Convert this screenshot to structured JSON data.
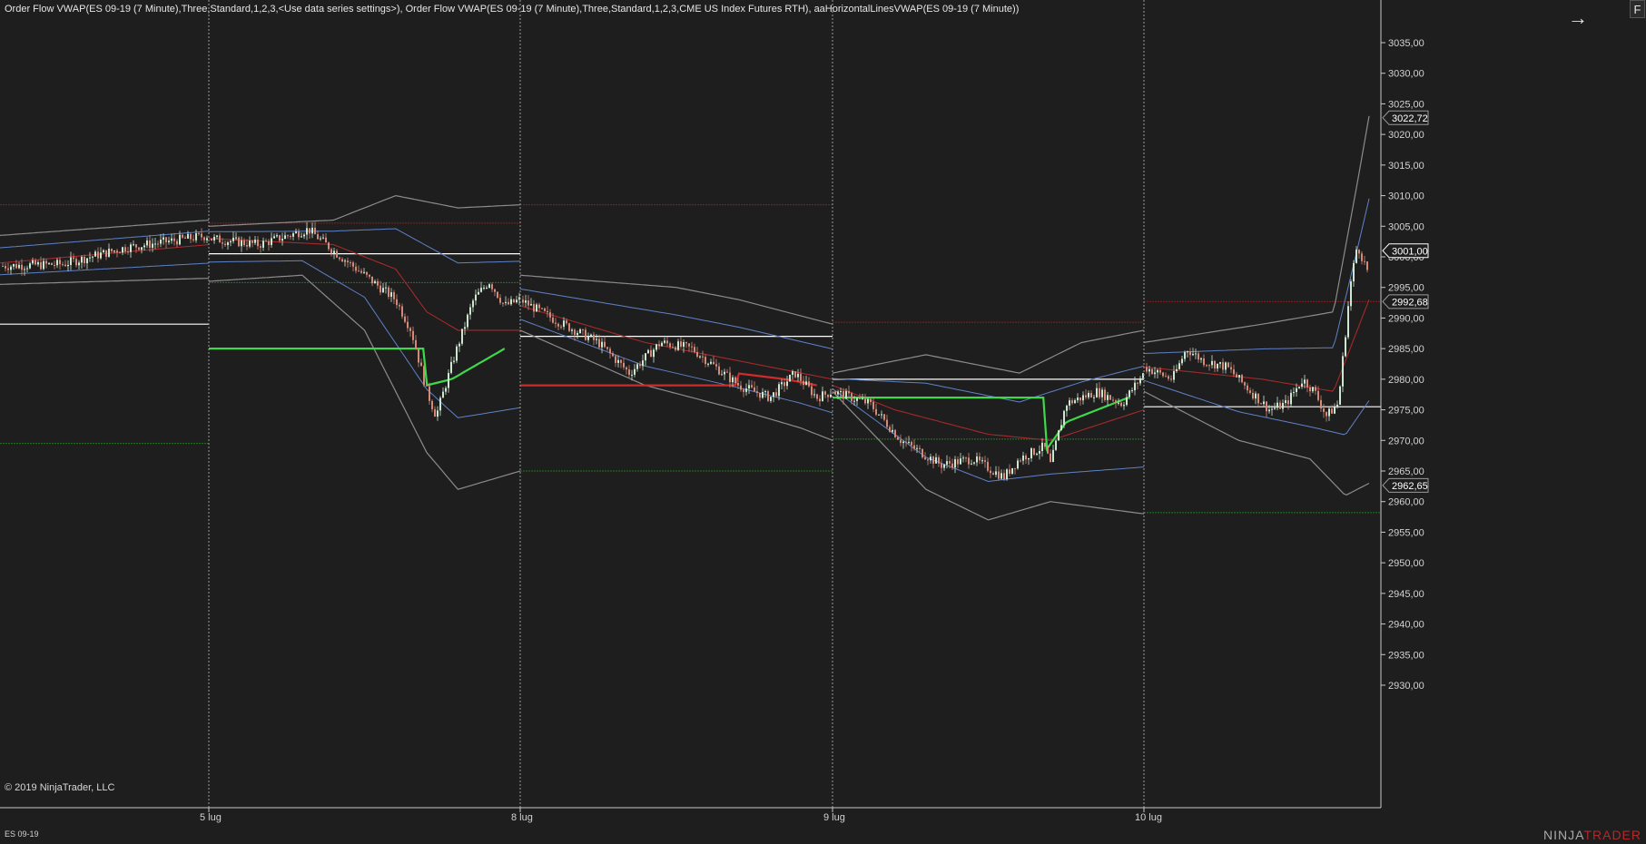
{
  "header": {
    "indicator_label": "Order Flow VWAP(ES 09-19 (7 Minute),Three,Standard,1,2,3,<Use data series settings>), Order Flow VWAP(ES 09-19 (7 Minute),Three,Standard,1,2,3,CME US Index Futures RTH), aaHorizontalLinesVWAP(ES 09-19 (7 Minute))",
    "f_button_label": "F",
    "arrow_icon": "arrow-right-icon",
    "arrow_glyph": "→"
  },
  "footer": {
    "copyright": "© 2019 NinjaTrader, LLC",
    "instrument": "ES 09-19",
    "brand_prefix": "NINJA",
    "brand_suffix": "TRADER"
  },
  "colors": {
    "background": "#1e1e1e",
    "vwap_band_gray": "#8c8c8c",
    "band_blue": "#5f82c8",
    "vwap_green": "#3fd84a",
    "vwap_red": "#d22a2a",
    "level_red": "#8b1e1e",
    "level_green": "#1f7a1f",
    "level_white": "#ffffff",
    "candle_up": "#cde6cf",
    "candle_down": "#d38a78"
  },
  "chart_data": {
    "type": "candlestick",
    "instrument": "ES 09-19",
    "timeframe": "7 Minute",
    "ylim": [
      2927,
      3040
    ],
    "y_ticks": [
      3035,
      3030,
      3025,
      3020,
      3015,
      3010,
      3005,
      3000,
      2995,
      2990,
      2985,
      2980,
      2975,
      2970,
      2965,
      2960,
      2955,
      2950,
      2945,
      2940,
      2935,
      2930
    ],
    "y_tick_labels": [
      "3035,00",
      "3030,00",
      "3025,00",
      "3020,00",
      "3015,00",
      "3010,00",
      "3005,00",
      "3000,00",
      "2995,00",
      "2990,00",
      "2985,00",
      "2980,00",
      "2975,00",
      "2970,00",
      "2965,00",
      "2960,00",
      "2955,00",
      "2950,00",
      "2945,00",
      "2940,00",
      "2935,00",
      "2930,00"
    ],
    "session_labels": [
      "5 lug",
      "8 lug",
      "9 lug",
      "10 lug"
    ],
    "sessions": [
      {
        "name": "pre",
        "price": [
          [
            0,
            2998.5
          ],
          [
            0.3,
            2998.8
          ],
          [
            0.6,
            3001.5
          ],
          [
            1,
            3003.5
          ]
        ],
        "vwap": [
          [
            0,
            2999
          ],
          [
            1,
            3002
          ]
        ],
        "upper": [
          [
            0,
            3003.5
          ],
          [
            1,
            3006
          ]
        ],
        "lower": [
          [
            0,
            2995.5
          ],
          [
            1,
            2996.5
          ]
        ]
      },
      {
        "name": "5 lug",
        "price": [
          [
            0,
            3003
          ],
          [
            0.16,
            3002
          ],
          [
            0.32,
            3004.5
          ],
          [
            0.4,
            3001
          ],
          [
            0.5,
            2997
          ],
          [
            0.6,
            2993
          ],
          [
            0.65,
            2988
          ],
          [
            0.7,
            2978
          ],
          [
            0.73,
            2974
          ],
          [
            0.79,
            2984
          ],
          [
            0.85,
            2993
          ],
          [
            0.9,
            2996
          ],
          [
            0.95,
            2992
          ],
          [
            1,
            2993
          ]
        ],
        "vwap": [
          [
            0,
            3003
          ],
          [
            0.4,
            3002
          ],
          [
            0.6,
            2998
          ],
          [
            0.7,
            2991
          ],
          [
            0.8,
            2988
          ],
          [
            1,
            2988
          ]
        ],
        "upper": [
          [
            0,
            3005
          ],
          [
            0.4,
            3006
          ],
          [
            0.6,
            3010
          ],
          [
            0.8,
            3008
          ],
          [
            1,
            3008.5
          ]
        ],
        "lower": [
          [
            0,
            2996
          ],
          [
            0.3,
            2997
          ],
          [
            0.5,
            2988
          ],
          [
            0.7,
            2968
          ],
          [
            0.8,
            2962
          ],
          [
            1,
            2965
          ]
        ]
      },
      {
        "name": "8 lug",
        "price": [
          [
            0,
            2993
          ],
          [
            0.1,
            2990
          ],
          [
            0.25,
            2986
          ],
          [
            0.35,
            2981
          ],
          [
            0.45,
            2986
          ],
          [
            0.55,
            2985
          ],
          [
            0.7,
            2979
          ],
          [
            0.8,
            2977
          ],
          [
            0.88,
            2981
          ],
          [
            0.95,
            2977
          ],
          [
            1,
            2978
          ]
        ],
        "vwap": [
          [
            0,
            2992
          ],
          [
            0.4,
            2986
          ],
          [
            0.7,
            2983
          ],
          [
            1,
            2980
          ]
        ],
        "upper": [
          [
            0,
            2997
          ],
          [
            0.5,
            2995
          ],
          [
            0.7,
            2993
          ],
          [
            0.85,
            2991
          ],
          [
            1,
            2989
          ]
        ],
        "lower": [
          [
            0,
            2988
          ],
          [
            0.4,
            2979
          ],
          [
            0.7,
            2975
          ],
          [
            0.9,
            2972
          ],
          [
            1,
            2970
          ]
        ]
      },
      {
        "name": "9 lug",
        "price": [
          [
            0,
            2978
          ],
          [
            0.12,
            2976
          ],
          [
            0.22,
            2970
          ],
          [
            0.35,
            2966
          ],
          [
            0.45,
            2967
          ],
          [
            0.55,
            2964
          ],
          [
            0.6,
            2967
          ],
          [
            0.68,
            2969
          ],
          [
            0.7,
            2966
          ],
          [
            0.75,
            2976
          ],
          [
            0.85,
            2978
          ],
          [
            0.93,
            2976
          ],
          [
            1,
            2981
          ]
        ],
        "vwap": [
          [
            0,
            2979
          ],
          [
            0.2,
            2975
          ],
          [
            0.5,
            2971
          ],
          [
            0.7,
            2970
          ],
          [
            1,
            2975
          ]
        ],
        "upper": [
          [
            0,
            2981
          ],
          [
            0.3,
            2984
          ],
          [
            0.6,
            2981
          ],
          [
            0.8,
            2986
          ],
          [
            1,
            2988
          ]
        ],
        "lower": [
          [
            0,
            2978
          ],
          [
            0.3,
            2962
          ],
          [
            0.5,
            2957
          ],
          [
            0.7,
            2960
          ],
          [
            1,
            2958
          ]
        ]
      },
      {
        "name": "10 lug",
        "price": [
          [
            0,
            2982
          ],
          [
            0.12,
            2980
          ],
          [
            0.18,
            2985
          ],
          [
            0.25,
            2983
          ],
          [
            0.35,
            2982
          ],
          [
            0.45,
            2978
          ],
          [
            0.53,
            2975
          ],
          [
            0.6,
            2976
          ],
          [
            0.67,
            2980
          ],
          [
            0.72,
            2978
          ],
          [
            0.77,
            2974
          ],
          [
            0.82,
            2976
          ],
          [
            0.87,
            2995
          ],
          [
            0.9,
            3002
          ],
          [
            0.93,
            2999
          ],
          [
            0.95,
            2997
          ]
        ],
        "vwap": [
          [
            0,
            2982
          ],
          [
            0.5,
            2980
          ],
          [
            0.8,
            2978
          ],
          [
            0.95,
            2993
          ]
        ],
        "upper": [
          [
            0,
            2986
          ],
          [
            0.5,
            2989
          ],
          [
            0.8,
            2991
          ],
          [
            0.9,
            3012
          ],
          [
            0.95,
            3023
          ]
        ],
        "lower": [
          [
            0,
            2978
          ],
          [
            0.4,
            2970
          ],
          [
            0.7,
            2967
          ],
          [
            0.85,
            2961
          ],
          [
            0.95,
            2963
          ]
        ]
      }
    ],
    "levels": [
      {
        "session": "pre",
        "color": "red",
        "price": 3008.5
      },
      {
        "session": "pre",
        "color": "white",
        "price": 2989
      },
      {
        "session": "pre",
        "color": "green",
        "price": 2969.5
      },
      {
        "session": "5 lug",
        "color": "red",
        "price": 3005.5
      },
      {
        "session": "5 lug",
        "color": "white",
        "price": 3000.5
      },
      {
        "session": "5 lug",
        "color": "green",
        "price": 2995.8
      },
      {
        "session": "8 lug",
        "color": "red",
        "price": 3008.5
      },
      {
        "session": "8 lug",
        "color": "white",
        "price": 2987
      },
      {
        "session": "8 lug",
        "color": "green",
        "price": 2965
      },
      {
        "session": "9 lug",
        "color": "red",
        "price": 2989.3
      },
      {
        "session": "9 lug",
        "color": "white",
        "price": 2980
      },
      {
        "session": "9 lug",
        "color": "green",
        "price": 2970.2
      },
      {
        "session": "10 lug",
        "color": "red",
        "price": 2992.7
      },
      {
        "session": "10 lug",
        "color": "white",
        "price": 2975.5
      },
      {
        "session": "10 lug",
        "color": "green",
        "price": 2958.2
      }
    ],
    "price_tags": [
      {
        "price": 3022.72,
        "label": "3022,72",
        "color": "#1e1e1e",
        "text_color": "#ffffff",
        "border": "#9a9a9a"
      },
      {
        "price": 3001.0,
        "label": "3001,00",
        "color": "#1e1e1e",
        "text_color": "#ffffff",
        "border": "#ffffff"
      },
      {
        "price": 2992.68,
        "label": "2992,68",
        "color": "#1e1e1e",
        "text_color": "#ffffff",
        "border": "#9a9a9a"
      },
      {
        "price": 2962.65,
        "label": "2962,65",
        "color": "#1e1e1e",
        "text_color": "#ffffff",
        "border": "#9a9a9a"
      }
    ],
    "grid": false,
    "legend": "none"
  }
}
